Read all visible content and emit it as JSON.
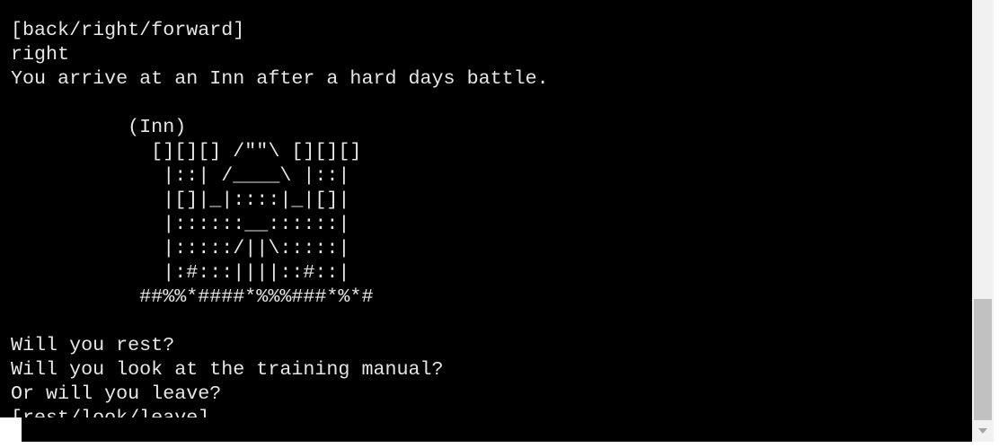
{
  "terminal": {
    "lines": [
      "      ",
      "[back/right/forward]",
      "right",
      "You arrive at an Inn after a hard days battle.",
      "",
      "          (Inn)",
      "            [][][] /\"\"\\ [][][]",
      "             |::| /____\\ |::|",
      "             |[]|_|::::|_|[]|",
      "             |::::::__::::::|",
      "             |:::::/||\\:::::|",
      "             |:#:::||||::#::|",
      "           ##%%*####*%%%###*%*#",
      "",
      "Will you rest?",
      "Will you look at the training manual?",
      "Or will you leave?",
      "[rest/look/leave]"
    ]
  },
  "scrollbar": {
    "position": 0.98
  },
  "colors": {
    "background": "#000000",
    "text": "#e6e6e6",
    "scrollbar_track": "#f1f1f1",
    "scrollbar_thumb": "#c1c1c1"
  }
}
